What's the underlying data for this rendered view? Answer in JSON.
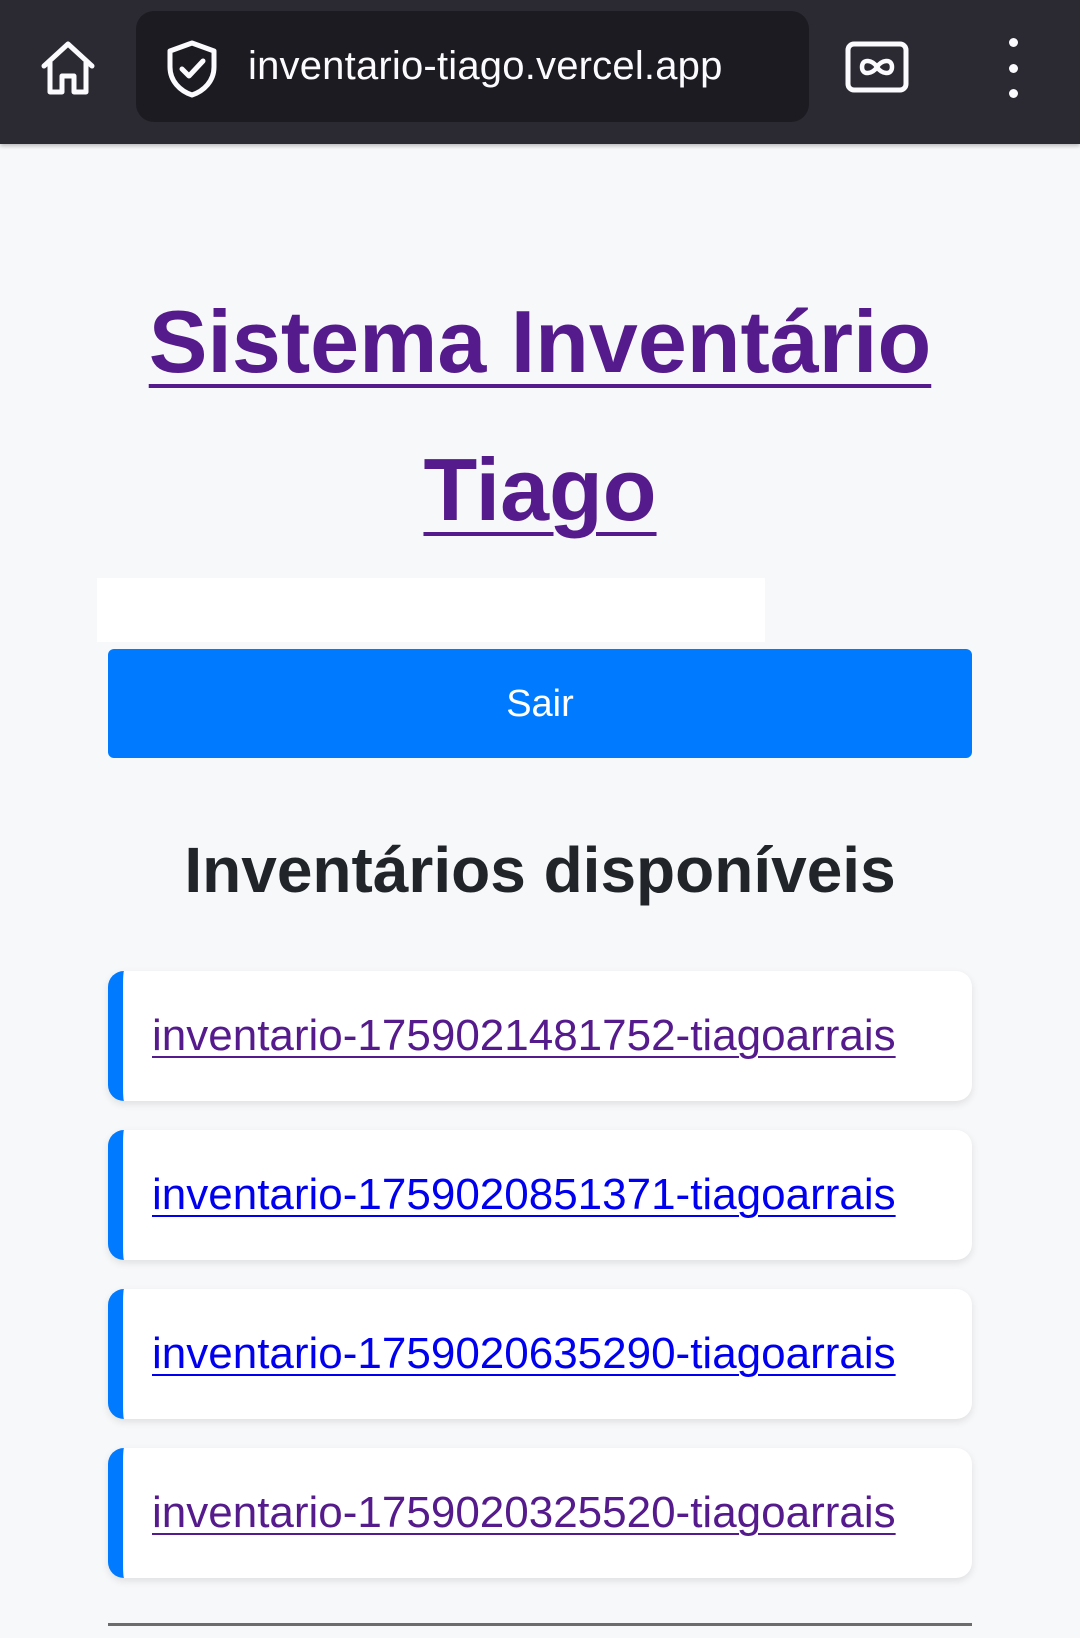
{
  "browser": {
    "url": "inventario-tiago.vercel.app",
    "icons": {
      "home": "home-icon",
      "security": "shield-check-icon",
      "tabs": "tabs-infinity-icon",
      "menu": "kebab-menu-icon"
    }
  },
  "page": {
    "title_line1": "Sistema Inventário",
    "title_line2": "Tiago",
    "logout_label": "Sair",
    "inventories_heading": "Inventários disponíveis",
    "inventories": [
      {
        "name": "inventario-1759021481752-tiagoarrais",
        "visited": true
      },
      {
        "name": "inventario-1759020851371-tiagoarrais",
        "visited": false
      },
      {
        "name": "inventario-1759020635290-tiagoarrais",
        "visited": false
      },
      {
        "name": "inventario-1759020325520-tiagoarrais",
        "visited": true
      }
    ]
  },
  "colors": {
    "topbar": "#2b2a33",
    "urlbar": "#1c1b22",
    "button_primary": "#007bff",
    "link_visited": "#551a8b",
    "link_unvisited": "#0000ee",
    "heading": "#212529"
  }
}
